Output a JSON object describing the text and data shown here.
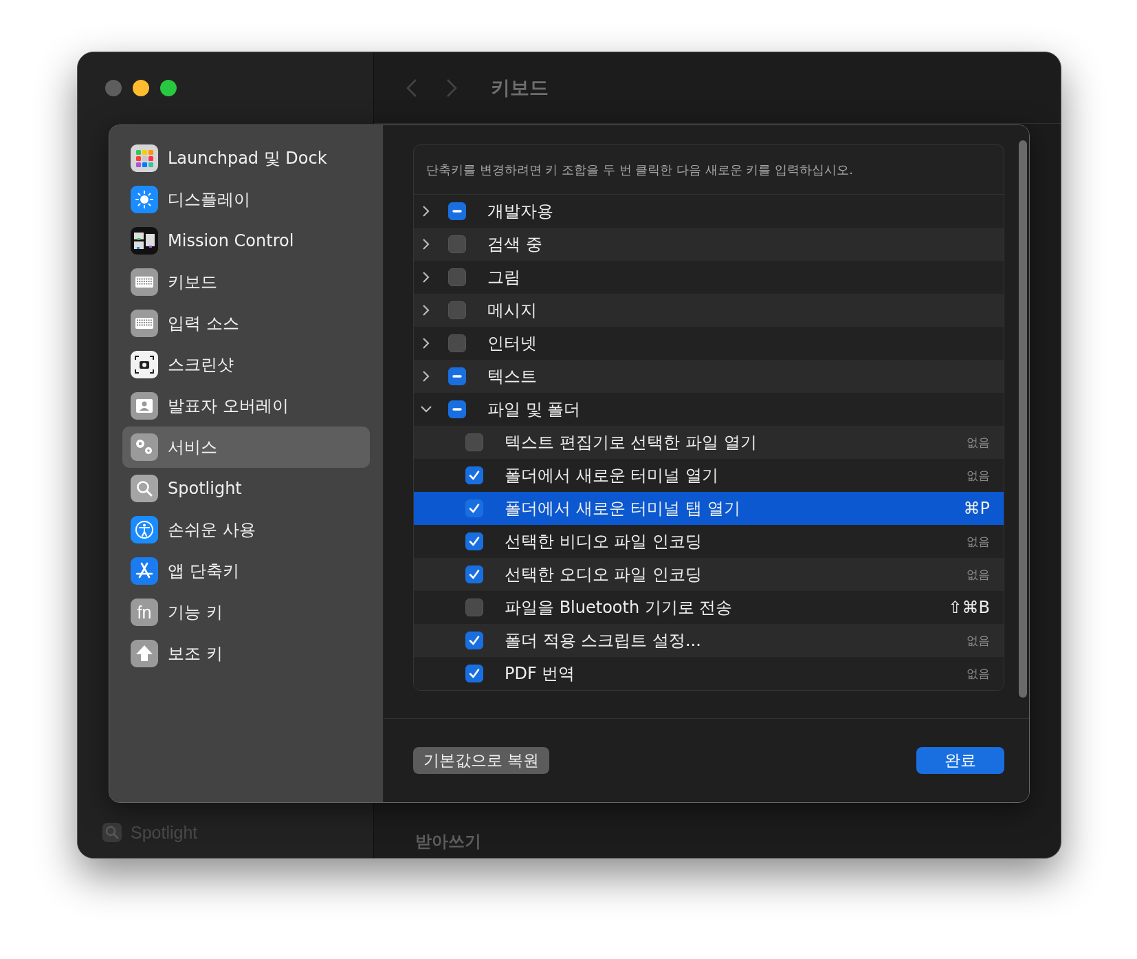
{
  "window": {
    "title": "키보드"
  },
  "background": {
    "sidebar_item": "Spotlight",
    "section_title": "받아쓰기"
  },
  "sheet": {
    "sidebar": {
      "items": [
        {
          "label": "Launchpad 및 Dock",
          "selected": false
        },
        {
          "label": "디스플레이",
          "selected": false
        },
        {
          "label": "Mission Control",
          "selected": false
        },
        {
          "label": "키보드",
          "selected": false
        },
        {
          "label": "입력 소스",
          "selected": false
        },
        {
          "label": "스크린샷",
          "selected": false
        },
        {
          "label": "발표자 오버레이",
          "selected": false
        },
        {
          "label": "서비스",
          "selected": true
        },
        {
          "label": "Spotlight",
          "selected": false
        },
        {
          "label": "손쉬운 사용",
          "selected": false
        },
        {
          "label": "앱 단축키",
          "selected": false
        },
        {
          "label": "기능 키",
          "selected": false,
          "glyph": "fn"
        },
        {
          "label": "보조 키",
          "selected": false
        }
      ]
    },
    "hint": "단축키를 변경하려면 키 조합을 두 번 클릭한 다음 새로운 키를 입력하십시오.",
    "groups": [
      {
        "label": "개발자용",
        "checked": true,
        "mixed": true,
        "expanded": false,
        "selected": false
      },
      {
        "label": "검색 중",
        "checked": false,
        "mixed": false,
        "expanded": false,
        "selected": false
      },
      {
        "label": "그림",
        "checked": false,
        "mixed": false,
        "expanded": false,
        "selected": false
      },
      {
        "label": "메시지",
        "checked": false,
        "mixed": false,
        "expanded": false,
        "selected": false
      },
      {
        "label": "인터넷",
        "checked": false,
        "mixed": false,
        "expanded": false,
        "selected": false
      },
      {
        "label": "텍스트",
        "checked": true,
        "mixed": true,
        "expanded": false,
        "selected": false
      },
      {
        "label": "파일 및 폴더",
        "checked": true,
        "mixed": true,
        "expanded": true,
        "selected": false,
        "children": [
          {
            "label": "텍스트 편집기로 선택한 파일 열기",
            "checked": false,
            "shortcut": "없음",
            "shortcut_assigned": false,
            "selected": false
          },
          {
            "label": "폴더에서 새로운 터미널 열기",
            "checked": true,
            "shortcut": "없음",
            "shortcut_assigned": false,
            "selected": false
          },
          {
            "label": "폴더에서 새로운 터미널 탭 열기",
            "checked": true,
            "shortcut": "⌘P",
            "shortcut_assigned": true,
            "selected": true
          },
          {
            "label": "선택한 비디오 파일 인코딩",
            "checked": true,
            "shortcut": "없음",
            "shortcut_assigned": false,
            "selected": false
          },
          {
            "label": "선택한 오디오 파일 인코딩",
            "checked": true,
            "shortcut": "없음",
            "shortcut_assigned": false,
            "selected": false
          },
          {
            "label": "파일을 Bluetooth 기기로 전송",
            "checked": false,
            "shortcut": "⇧⌘B",
            "shortcut_assigned": true,
            "selected": false
          },
          {
            "label": "폴더 적용 스크립트 설정...",
            "checked": true,
            "shortcut": "없음",
            "shortcut_assigned": false,
            "selected": false
          },
          {
            "label": "PDF 번역",
            "checked": true,
            "shortcut": "없음",
            "shortcut_assigned": false,
            "selected": false
          }
        ]
      }
    ],
    "buttons": [
      {
        "label": "기본값으로 복원",
        "kind": "secondary"
      },
      {
        "label": "완료",
        "kind": "primary"
      }
    ]
  }
}
